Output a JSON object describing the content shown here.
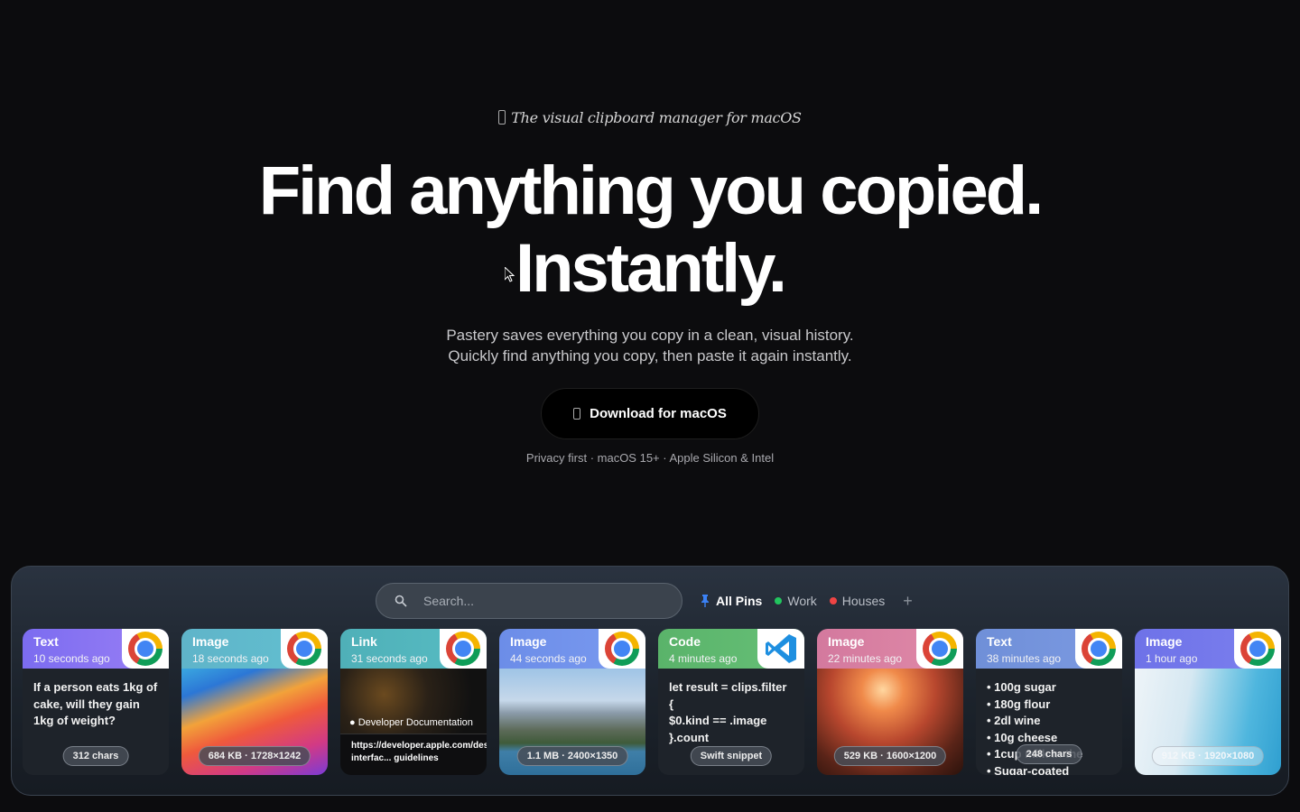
{
  "hero": {
    "tagline": "The visual clipboard manager for macOS",
    "headline_line1": "Find anything you copied.",
    "headline_line2": "Instantly.",
    "subtitle_line1": "Pastery saves everything you copy in a clean, visual history.",
    "subtitle_line2": "Quickly find anything you copy, then paste it again instantly.",
    "download_label": "Download for macOS",
    "meta": "Privacy first · macOS 15+ · Apple Silicon & Intel"
  },
  "panel": {
    "search_placeholder": "Search...",
    "pins": [
      {
        "label": "All Pins",
        "color": "#3b82f6",
        "icon": "pin-icon"
      },
      {
        "label": "Work",
        "color": "#22c55e"
      },
      {
        "label": "Houses",
        "color": "#ef4444"
      }
    ],
    "add_label": "+",
    "cards": [
      {
        "kind": "Text",
        "time": "10 seconds ago",
        "app": "chrome-icon",
        "header_color": "#7b6cf0",
        "content": "If a person eats 1kg of cake, will they gain 1kg of weight?",
        "badge": "312 chars"
      },
      {
        "kind": "Image",
        "time": "18 seconds ago",
        "app": "chrome-icon",
        "header_color": "#5fb4c9",
        "badge": "684 KB · 1728×1242"
      },
      {
        "kind": "Link",
        "time": "31 seconds ago",
        "app": "chrome-icon",
        "header_color": "#4fb0b8",
        "preview_title": "Developer Documentation",
        "url": "https://developer.apple.com/design/human-interfac... guidelines"
      },
      {
        "kind": "Image",
        "time": "44 seconds ago",
        "app": "chrome-icon",
        "header_color": "#6c8de8",
        "badge": "1.1 MB · 2400×1350"
      },
      {
        "kind": "Code",
        "time": "4 minutes ago",
        "app": "vscode-icon",
        "header_color": "#5ab36a",
        "content_lines": [
          "let result = clips.filter {",
          "$0.kind == .image",
          "}.count"
        ],
        "badge": "Swift snippet"
      },
      {
        "kind": "Image",
        "time": "22 minutes ago",
        "app": "chrome-icon",
        "header_color": "#d3799e",
        "badge": "529 KB · 1600×1200"
      },
      {
        "kind": "Text",
        "time": "38 minutes ago",
        "app": "chrome-icon",
        "header_color": "#6f8fd8",
        "content_lines": [
          "• 100g sugar",
          "• 180g flour",
          "• 2dl wine",
          "• 10g cheese",
          "• 1cup milk in the",
          "• Sugar-coated"
        ],
        "badge": "248 chars"
      },
      {
        "kind": "Image",
        "time": "1 hour ago",
        "app": "chrome-icon",
        "header_color": "#6e72e8",
        "badge": "912 KB · 1920×1080"
      }
    ]
  }
}
